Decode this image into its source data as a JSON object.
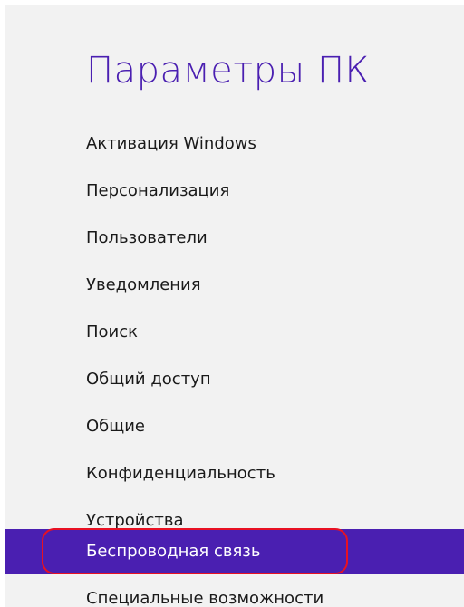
{
  "colors": {
    "accent": "#4a1fb1",
    "title": "#4a1fb1",
    "panel_background": "#f2f2f2",
    "selected_text": "#ffffff",
    "annotation_ring": "#e81123"
  },
  "page": {
    "title": "Параметры ПК"
  },
  "nav": {
    "selected_index": 9,
    "items": [
      {
        "label": "Активация Windows"
      },
      {
        "label": "Персонализация"
      },
      {
        "label": "Пользователи"
      },
      {
        "label": "Уведомления"
      },
      {
        "label": "Поиск"
      },
      {
        "label": "Общий доступ"
      },
      {
        "label": "Общие"
      },
      {
        "label": "Конфиденциальность"
      },
      {
        "label": "Устройства"
      },
      {
        "label": "Беспроводная связь"
      },
      {
        "label": "Специальные возможности"
      }
    ]
  }
}
